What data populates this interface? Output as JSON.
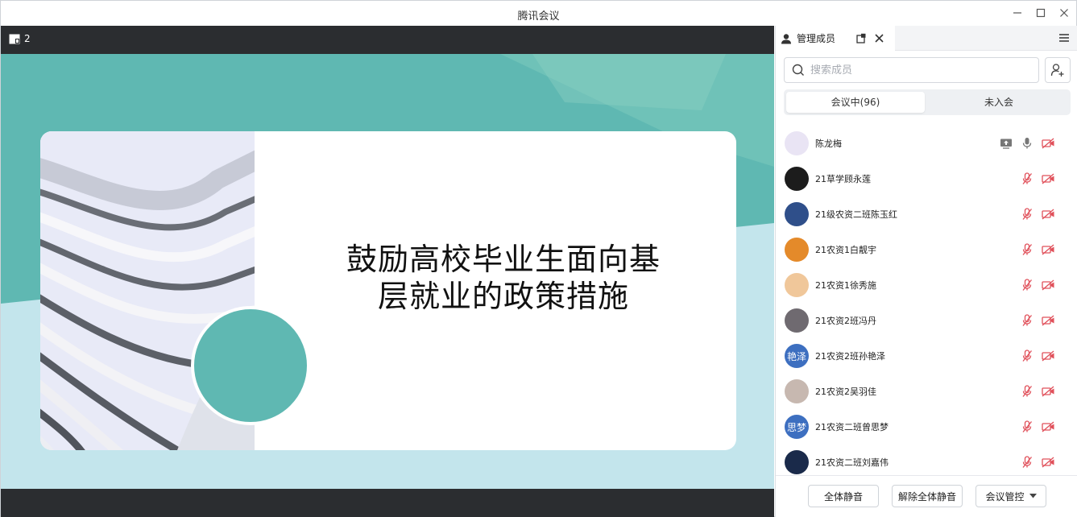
{
  "window": {
    "title": "腾讯会议"
  },
  "stage": {
    "layout_count": "2",
    "slide_title": "鼓励高校毕业生面向基层就业的政策措施"
  },
  "panel": {
    "tab_label": "管理成员",
    "search_placeholder": "搜索成员",
    "seg_in_meeting": "会议中(96)",
    "seg_not_joined": "未入会",
    "members": [
      {
        "name": "陈龙梅",
        "avatar_text": "",
        "avatar_color": "#e9e4f4",
        "screen_share": true,
        "mic": "on",
        "video": "off"
      },
      {
        "name": "21草学顾永莲",
        "avatar_text": "",
        "avatar_color": "#1c1c1c",
        "screen_share": false,
        "mic": "off",
        "video": "off"
      },
      {
        "name": "21级农资二班陈玉红",
        "avatar_text": "",
        "avatar_color": "#2f4f8a",
        "screen_share": false,
        "mic": "off",
        "video": "off"
      },
      {
        "name": "21农资1白靓宇",
        "avatar_text": "",
        "avatar_color": "#e48a2a",
        "screen_share": false,
        "mic": "off",
        "video": "off"
      },
      {
        "name": "21农资1徐秀施",
        "avatar_text": "",
        "avatar_color": "#f0c79a",
        "screen_share": false,
        "mic": "off",
        "video": "off"
      },
      {
        "name": "21农资2班冯丹",
        "avatar_text": "",
        "avatar_color": "#6f6a70",
        "screen_share": false,
        "mic": "off",
        "video": "off"
      },
      {
        "name": "21农资2班孙艳泽",
        "avatar_text": "艳泽",
        "avatar_color": "#3d6fc0",
        "screen_share": false,
        "mic": "off",
        "video": "off"
      },
      {
        "name": "21农资2吴羽佳",
        "avatar_text": "",
        "avatar_color": "#c7b8b0",
        "screen_share": false,
        "mic": "off",
        "video": "off"
      },
      {
        "name": "21农资二班曾思梦",
        "avatar_text": "思梦",
        "avatar_color": "#3d6fc0",
        "screen_share": false,
        "mic": "off",
        "video": "off"
      },
      {
        "name": "21农资二班刘嘉伟",
        "avatar_text": "",
        "avatar_color": "#1a2a4a",
        "screen_share": false,
        "mic": "off",
        "video": "off"
      }
    ],
    "footer": {
      "mute_all": "全体静音",
      "unmute_all": "解除全体静音",
      "meeting_control": "会议管控"
    }
  },
  "colors": {
    "stage_bg": "#2b2d30",
    "slide_bg": "#c3e5ec",
    "teal": "#5fb8b2",
    "muted_red": "#e0505a"
  }
}
